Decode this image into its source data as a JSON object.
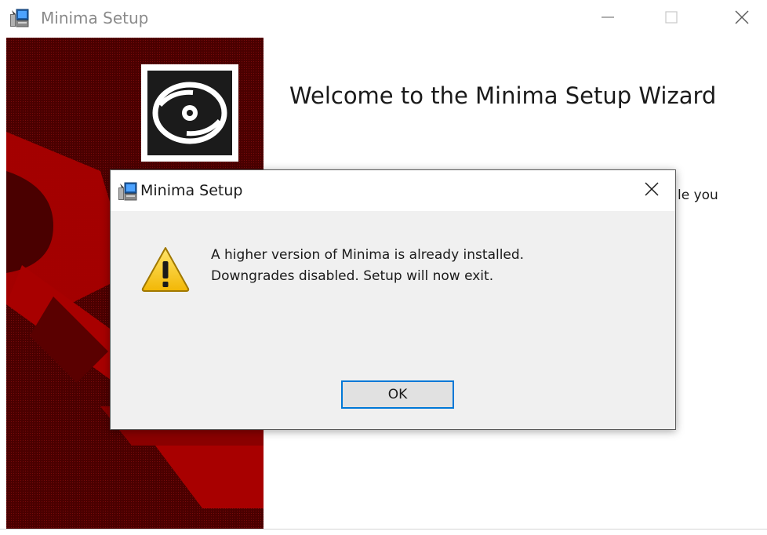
{
  "window": {
    "title": "Minima Setup",
    "icon": "installer-icon",
    "controls": {
      "minimize_icon": "minimize-icon",
      "maximize_icon": "maximize-icon",
      "close_icon": "close-icon"
    }
  },
  "wizard": {
    "heading": "Welcome to the Minima Setup Wizard",
    "body_partial": "le you",
    "banner_icon": "disc-icon",
    "banner_colors": {
      "background": "#5a0000",
      "accent": "#a80000"
    }
  },
  "dialog": {
    "title": "Minima Setup",
    "icon": "installer-icon",
    "close_icon": "close-icon",
    "warning_icon": "warning-icon",
    "message_lines": [
      "A higher version of Minima is already installed.",
      "Downgrades disabled. Setup will now exit."
    ],
    "ok_label": "OK",
    "accent_color": "#0078d7"
  }
}
